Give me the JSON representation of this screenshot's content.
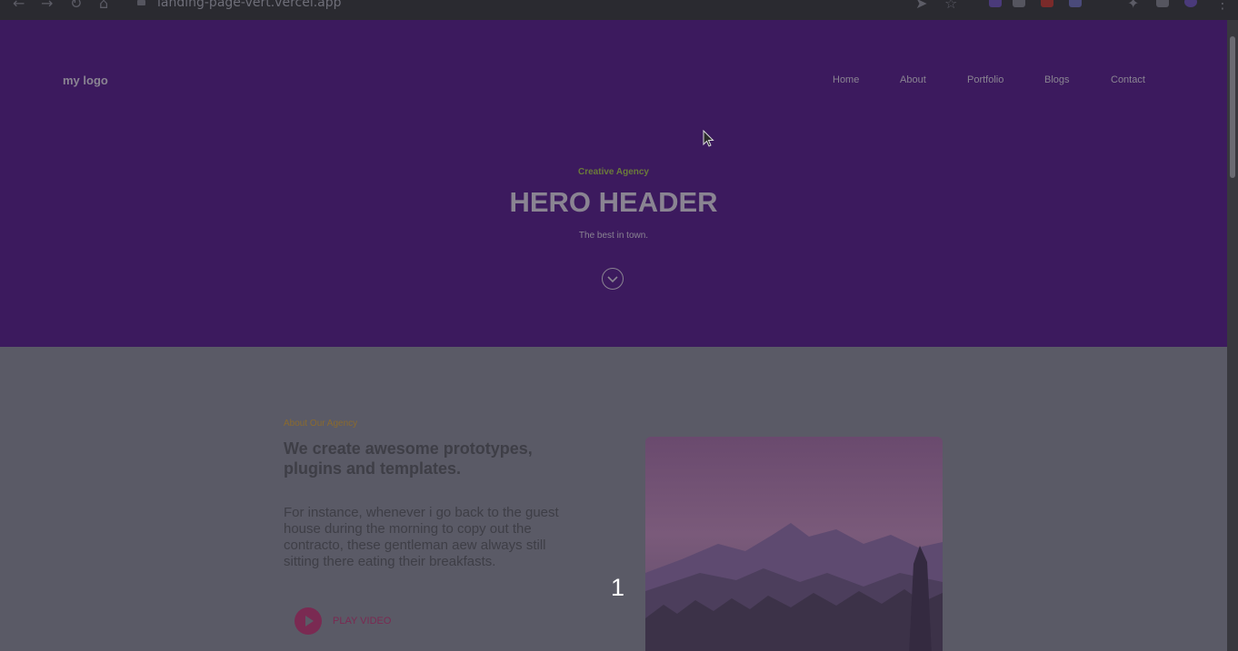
{
  "browser": {
    "url": "landing-page-vert.vercel.app"
  },
  "header": {
    "logo": "my logo",
    "nav": [
      "Home",
      "About",
      "Portfolio",
      "Blogs",
      "Contact"
    ]
  },
  "hero": {
    "kicker": "Creative Agency",
    "title": "HERO HEADER",
    "tagline": "The best in town.",
    "scroll_icon": "chevron-down-circle-icon"
  },
  "about": {
    "label": "About Our Agency",
    "title": "We create awesome prototypes, plugins and templates.",
    "text": "For instance, whenever i go back to the guest house during the morning to copy out the contracto, these gentleman aew always still sitting there eating their breakfasts.",
    "play_label": "PLAY VIDEO",
    "play_icon": "play-icon",
    "image": "mountain-landscape"
  },
  "overlay": {
    "slide_number": "1"
  },
  "colors": {
    "hero_bg": "#3c1a5e",
    "body_bg": "#5a5a66",
    "accent_label": "#8a6a2e",
    "play_accent": "#7a2a52"
  }
}
